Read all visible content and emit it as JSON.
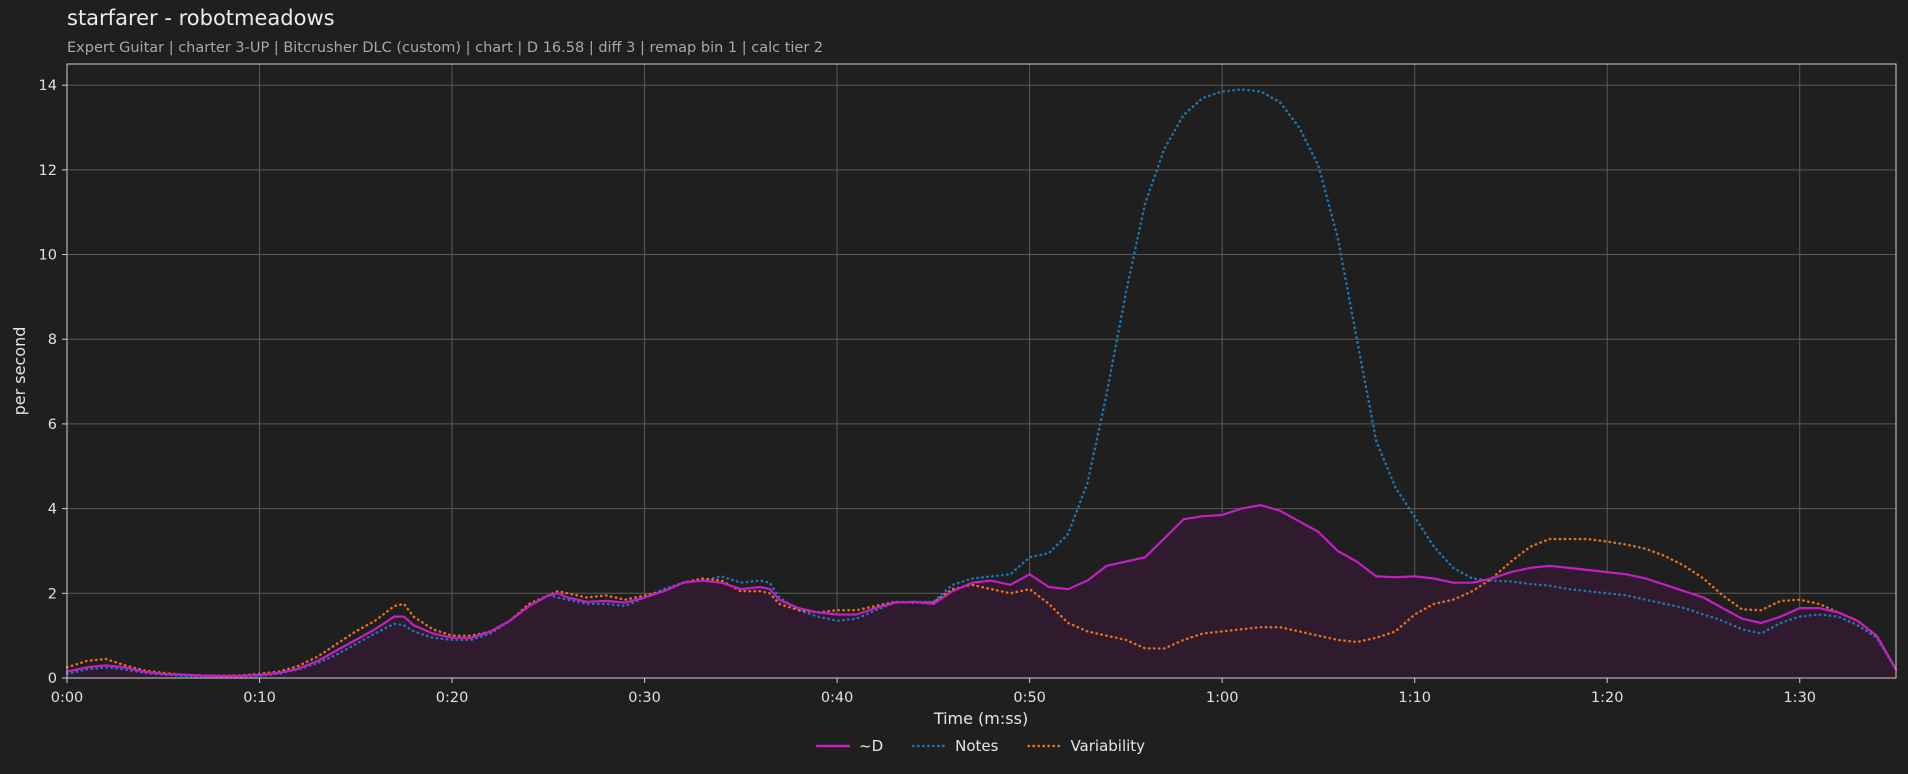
{
  "title": "starfarer - robotmeadows",
  "subtitle": "Expert Guitar  |  charter 3-UP  |  Bitcrusher DLC (custom)  |  chart  |  D 16.58  |  diff 3  |  remap bin 1  |  calc tier 2",
  "colors": {
    "background": "#1f1f1f",
    "grid": "#5a5a5a",
    "d_line": "#c41fc4",
    "d_fill": "#2f1a2e",
    "notes": "#1f77b4",
    "variability": "#e8711b"
  },
  "chart_data": {
    "type": "line",
    "xlabel": "Time (m:ss)",
    "ylabel": "per second",
    "xlim": [
      0,
      95
    ],
    "ylim": [
      0,
      14.5
    ],
    "grid": true,
    "legend_placement": "bottom-center",
    "x_ticks": [
      {
        "value": 0,
        "label": "0:00"
      },
      {
        "value": 10,
        "label": "0:10"
      },
      {
        "value": 20,
        "label": "0:20"
      },
      {
        "value": 30,
        "label": "0:30"
      },
      {
        "value": 40,
        "label": "0:40"
      },
      {
        "value": 50,
        "label": "0:50"
      },
      {
        "value": 60,
        "label": "1:00"
      },
      {
        "value": 70,
        "label": "1:10"
      },
      {
        "value": 80,
        "label": "1:20"
      },
      {
        "value": 90,
        "label": "1:30"
      }
    ],
    "y_ticks": [
      {
        "value": 0,
        "label": "0"
      },
      {
        "value": 2,
        "label": "2"
      },
      {
        "value": 4,
        "label": "4"
      },
      {
        "value": 6,
        "label": "6"
      },
      {
        "value": 8,
        "label": "8"
      },
      {
        "value": 10,
        "label": "10"
      },
      {
        "value": 12,
        "label": "12"
      },
      {
        "value": 14,
        "label": "14"
      }
    ],
    "series": [
      {
        "name": "~D",
        "style": "solid",
        "color": "#c41fc4",
        "fill": true,
        "points": [
          [
            0,
            0.15
          ],
          [
            1,
            0.25
          ],
          [
            2,
            0.3
          ],
          [
            3,
            0.25
          ],
          [
            4,
            0.15
          ],
          [
            5,
            0.1
          ],
          [
            6,
            0.08
          ],
          [
            7,
            0.06
          ],
          [
            8,
            0.05
          ],
          [
            9,
            0.05
          ],
          [
            10,
            0.07
          ],
          [
            11,
            0.12
          ],
          [
            12,
            0.22
          ],
          [
            13,
            0.4
          ],
          [
            14,
            0.65
          ],
          [
            15,
            0.9
          ],
          [
            16,
            1.15
          ],
          [
            17,
            1.45
          ],
          [
            17.5,
            1.45
          ],
          [
            18,
            1.25
          ],
          [
            19,
            1.05
          ],
          [
            20,
            0.95
          ],
          [
            21,
            0.95
          ],
          [
            22,
            1.1
          ],
          [
            23,
            1.35
          ],
          [
            24,
            1.7
          ],
          [
            25,
            1.95
          ],
          [
            25.5,
            2.0
          ],
          [
            26,
            1.9
          ],
          [
            27,
            1.8
          ],
          [
            28,
            1.82
          ],
          [
            29,
            1.78
          ],
          [
            30,
            1.9
          ],
          [
            31,
            2.05
          ],
          [
            32,
            2.25
          ],
          [
            33,
            2.3
          ],
          [
            34,
            2.25
          ],
          [
            35,
            2.1
          ],
          [
            36,
            2.15
          ],
          [
            36.5,
            2.1
          ],
          [
            37,
            1.85
          ],
          [
            38,
            1.65
          ],
          [
            39,
            1.55
          ],
          [
            40,
            1.5
          ],
          [
            41,
            1.5
          ],
          [
            42,
            1.65
          ],
          [
            43,
            1.78
          ],
          [
            44,
            1.8
          ],
          [
            45,
            1.75
          ],
          [
            46,
            2.05
          ],
          [
            47,
            2.25
          ],
          [
            48,
            2.3
          ],
          [
            49,
            2.2
          ],
          [
            50,
            2.45
          ],
          [
            51,
            2.15
          ],
          [
            52,
            2.1
          ],
          [
            53,
            2.3
          ],
          [
            54,
            2.65
          ],
          [
            55,
            2.75
          ],
          [
            56,
            2.85
          ],
          [
            57,
            3.3
          ],
          [
            58,
            3.75
          ],
          [
            59,
            3.82
          ],
          [
            60,
            3.85
          ],
          [
            61,
            4.0
          ],
          [
            62,
            4.08
          ],
          [
            63,
            3.95
          ],
          [
            64,
            3.7
          ],
          [
            65,
            3.45
          ],
          [
            66,
            3.0
          ],
          [
            67,
            2.75
          ],
          [
            68,
            2.4
          ],
          [
            69,
            2.38
          ],
          [
            70,
            2.4
          ],
          [
            71,
            2.35
          ],
          [
            72,
            2.25
          ],
          [
            73,
            2.25
          ],
          [
            74,
            2.35
          ],
          [
            75,
            2.5
          ],
          [
            76,
            2.6
          ],
          [
            77,
            2.65
          ],
          [
            78,
            2.6
          ],
          [
            79,
            2.55
          ],
          [
            80,
            2.5
          ],
          [
            81,
            2.45
          ],
          [
            82,
            2.35
          ],
          [
            83,
            2.2
          ],
          [
            84,
            2.05
          ],
          [
            85,
            1.9
          ],
          [
            86,
            1.65
          ],
          [
            87,
            1.4
          ],
          [
            88,
            1.3
          ],
          [
            89,
            1.45
          ],
          [
            90,
            1.65
          ],
          [
            91,
            1.65
          ],
          [
            92,
            1.55
          ],
          [
            93,
            1.35
          ],
          [
            94,
            1.0
          ],
          [
            95,
            0.2
          ]
        ]
      },
      {
        "name": "Notes",
        "style": "dotted",
        "color": "#1f77b4",
        "fill": false,
        "points": [
          [
            0,
            0.1
          ],
          [
            1,
            0.2
          ],
          [
            2,
            0.25
          ],
          [
            3,
            0.2
          ],
          [
            4,
            0.12
          ],
          [
            5,
            0.08
          ],
          [
            6,
            0.05
          ],
          [
            7,
            0.04
          ],
          [
            8,
            0.04
          ],
          [
            9,
            0.04
          ],
          [
            10,
            0.05
          ],
          [
            11,
            0.1
          ],
          [
            12,
            0.2
          ],
          [
            13,
            0.35
          ],
          [
            14,
            0.55
          ],
          [
            15,
            0.8
          ],
          [
            16,
            1.05
          ],
          [
            17,
            1.28
          ],
          [
            17.5,
            1.25
          ],
          [
            18,
            1.1
          ],
          [
            19,
            0.95
          ],
          [
            20,
            0.9
          ],
          [
            21,
            0.9
          ],
          [
            22,
            1.05
          ],
          [
            23,
            1.35
          ],
          [
            24,
            1.7
          ],
          [
            25,
            1.95
          ],
          [
            26,
            1.85
          ],
          [
            27,
            1.75
          ],
          [
            28,
            1.75
          ],
          [
            29,
            1.7
          ],
          [
            30,
            1.9
          ],
          [
            31,
            2.1
          ],
          [
            32,
            2.25
          ],
          [
            33,
            2.3
          ],
          [
            34,
            2.4
          ],
          [
            35,
            2.25
          ],
          [
            36,
            2.3
          ],
          [
            36.5,
            2.25
          ],
          [
            37,
            1.9
          ],
          [
            38,
            1.6
          ],
          [
            39,
            1.45
          ],
          [
            40,
            1.35
          ],
          [
            41,
            1.4
          ],
          [
            42,
            1.6
          ],
          [
            43,
            1.78
          ],
          [
            44,
            1.8
          ],
          [
            45,
            1.8
          ],
          [
            46,
            2.2
          ],
          [
            47,
            2.35
          ],
          [
            48,
            2.4
          ],
          [
            49,
            2.45
          ],
          [
            50,
            2.85
          ],
          [
            51,
            2.95
          ],
          [
            52,
            3.4
          ],
          [
            53,
            4.6
          ],
          [
            54,
            6.7
          ],
          [
            55,
            9.1
          ],
          [
            56,
            11.2
          ],
          [
            57,
            12.5
          ],
          [
            58,
            13.3
          ],
          [
            59,
            13.7
          ],
          [
            60,
            13.85
          ],
          [
            61,
            13.9
          ],
          [
            62,
            13.85
          ],
          [
            63,
            13.6
          ],
          [
            64,
            13.0
          ],
          [
            65,
            12.1
          ],
          [
            66,
            10.4
          ],
          [
            67,
            8.0
          ],
          [
            68,
            5.6
          ],
          [
            69,
            4.5
          ],
          [
            70,
            3.8
          ],
          [
            71,
            3.1
          ],
          [
            72,
            2.6
          ],
          [
            73,
            2.35
          ],
          [
            74,
            2.3
          ],
          [
            75,
            2.28
          ],
          [
            76,
            2.22
          ],
          [
            77,
            2.18
          ],
          [
            78,
            2.1
          ],
          [
            79,
            2.05
          ],
          [
            80,
            2.0
          ],
          [
            81,
            1.95
          ],
          [
            82,
            1.85
          ],
          [
            83,
            1.75
          ],
          [
            84,
            1.65
          ],
          [
            85,
            1.5
          ],
          [
            86,
            1.35
          ],
          [
            87,
            1.15
          ],
          [
            88,
            1.05
          ],
          [
            89,
            1.3
          ],
          [
            90,
            1.45
          ],
          [
            91,
            1.5
          ],
          [
            92,
            1.45
          ],
          [
            93,
            1.25
          ],
          [
            94,
            0.95
          ],
          [
            95,
            0.2
          ]
        ]
      },
      {
        "name": "Variability",
        "style": "dotted",
        "color": "#e8711b",
        "fill": false,
        "points": [
          [
            0,
            0.25
          ],
          [
            1,
            0.4
          ],
          [
            2,
            0.45
          ],
          [
            3,
            0.3
          ],
          [
            4,
            0.18
          ],
          [
            5,
            0.12
          ],
          [
            6,
            0.08
          ],
          [
            7,
            0.06
          ],
          [
            8,
            0.05
          ],
          [
            9,
            0.06
          ],
          [
            10,
            0.1
          ],
          [
            11,
            0.15
          ],
          [
            12,
            0.28
          ],
          [
            13,
            0.5
          ],
          [
            14,
            0.8
          ],
          [
            15,
            1.1
          ],
          [
            16,
            1.35
          ],
          [
            17,
            1.7
          ],
          [
            17.5,
            1.75
          ],
          [
            18,
            1.45
          ],
          [
            19,
            1.15
          ],
          [
            20,
            1.0
          ],
          [
            21,
            1.0
          ],
          [
            22,
            1.1
          ],
          [
            23,
            1.35
          ],
          [
            24,
            1.75
          ],
          [
            25,
            1.95
          ],
          [
            25.5,
            2.05
          ],
          [
            26,
            2.0
          ],
          [
            27,
            1.9
          ],
          [
            28,
            1.95
          ],
          [
            29,
            1.85
          ],
          [
            30,
            1.95
          ],
          [
            31,
            2.05
          ],
          [
            32,
            2.25
          ],
          [
            33,
            2.35
          ],
          [
            34,
            2.3
          ],
          [
            35,
            2.05
          ],
          [
            36,
            2.05
          ],
          [
            36.5,
            2.0
          ],
          [
            37,
            1.75
          ],
          [
            38,
            1.6
          ],
          [
            39,
            1.55
          ],
          [
            40,
            1.6
          ],
          [
            41,
            1.6
          ],
          [
            42,
            1.7
          ],
          [
            43,
            1.8
          ],
          [
            44,
            1.78
          ],
          [
            45,
            1.78
          ],
          [
            46,
            2.1
          ],
          [
            47,
            2.2
          ],
          [
            48,
            2.1
          ],
          [
            49,
            2.0
          ],
          [
            50,
            2.1
          ],
          [
            51,
            1.75
          ],
          [
            52,
            1.3
          ],
          [
            53,
            1.1
          ],
          [
            54,
            1.0
          ],
          [
            55,
            0.9
          ],
          [
            56,
            0.7
          ],
          [
            57,
            0.7
          ],
          [
            58,
            0.9
          ],
          [
            59,
            1.05
          ],
          [
            60,
            1.1
          ],
          [
            61,
            1.15
          ],
          [
            62,
            1.2
          ],
          [
            63,
            1.2
          ],
          [
            64,
            1.1
          ],
          [
            65,
            1.0
          ],
          [
            66,
            0.9
          ],
          [
            67,
            0.85
          ],
          [
            68,
            0.95
          ],
          [
            69,
            1.1
          ],
          [
            70,
            1.5
          ],
          [
            71,
            1.75
          ],
          [
            72,
            1.85
          ],
          [
            73,
            2.05
          ],
          [
            74,
            2.35
          ],
          [
            75,
            2.75
          ],
          [
            76,
            3.1
          ],
          [
            77,
            3.28
          ],
          [
            78,
            3.28
          ],
          [
            79,
            3.28
          ],
          [
            80,
            3.22
          ],
          [
            81,
            3.15
          ],
          [
            82,
            3.05
          ],
          [
            83,
            2.88
          ],
          [
            84,
            2.65
          ],
          [
            85,
            2.35
          ],
          [
            86,
            1.95
          ],
          [
            87,
            1.62
          ],
          [
            88,
            1.6
          ],
          [
            89,
            1.82
          ],
          [
            90,
            1.85
          ],
          [
            91,
            1.75
          ],
          [
            92,
            1.55
          ],
          [
            93,
            1.35
          ],
          [
            94,
            1.0
          ],
          [
            95,
            0.2
          ]
        ]
      }
    ]
  }
}
